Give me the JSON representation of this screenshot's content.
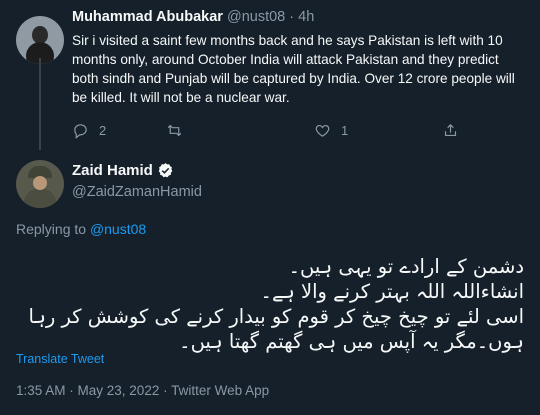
{
  "reply_tweet": {
    "author_name": "Muhammad Abubakar",
    "author_handle": "@nust08",
    "separator": "·",
    "time": "4h",
    "text": "Sir i visited a saint few months back and he says Pakistan is left with 10 months only, around October India will attack Pakistan and they predict both sindh and Punjab will be captured by India. Over 12 crore people will be killed. It will not be a nuclear war.",
    "actions": {
      "reply_count": "2",
      "retweet_count": "",
      "like_count": "1"
    },
    "icons": [
      "reply-icon",
      "retweet-icon",
      "like-icon",
      "share-icon"
    ]
  },
  "main_tweet": {
    "author_name": "Zaid Hamid",
    "author_handle": "@ZaidZamanHamid",
    "verified": true,
    "replying_to_prefix": "Replying to",
    "replying_to_handle": "@nust08",
    "text_lines": [
      "دشمن کے ارادے تو یہی ہیں۔",
      "انشاءاللہ اللہ بہتر کرنے والا ہے۔",
      "اسی لئے تو چیخ چیخ کر قوم کو بیدار کرنے کی کوشش کر رہا ہوں۔مگر یہ آپس میں ہی  گھتم گھتا ہیں۔"
    ],
    "translate_label": "Translate Tweet",
    "timestamp": "1:35 AM · May 23, 2022 · Twitter Web App"
  },
  "colors": {
    "background": "#15202b",
    "text": "#f7f9f9",
    "muted": "#8b98a5",
    "link": "#1d9bf0",
    "divider": "#38444d"
  }
}
